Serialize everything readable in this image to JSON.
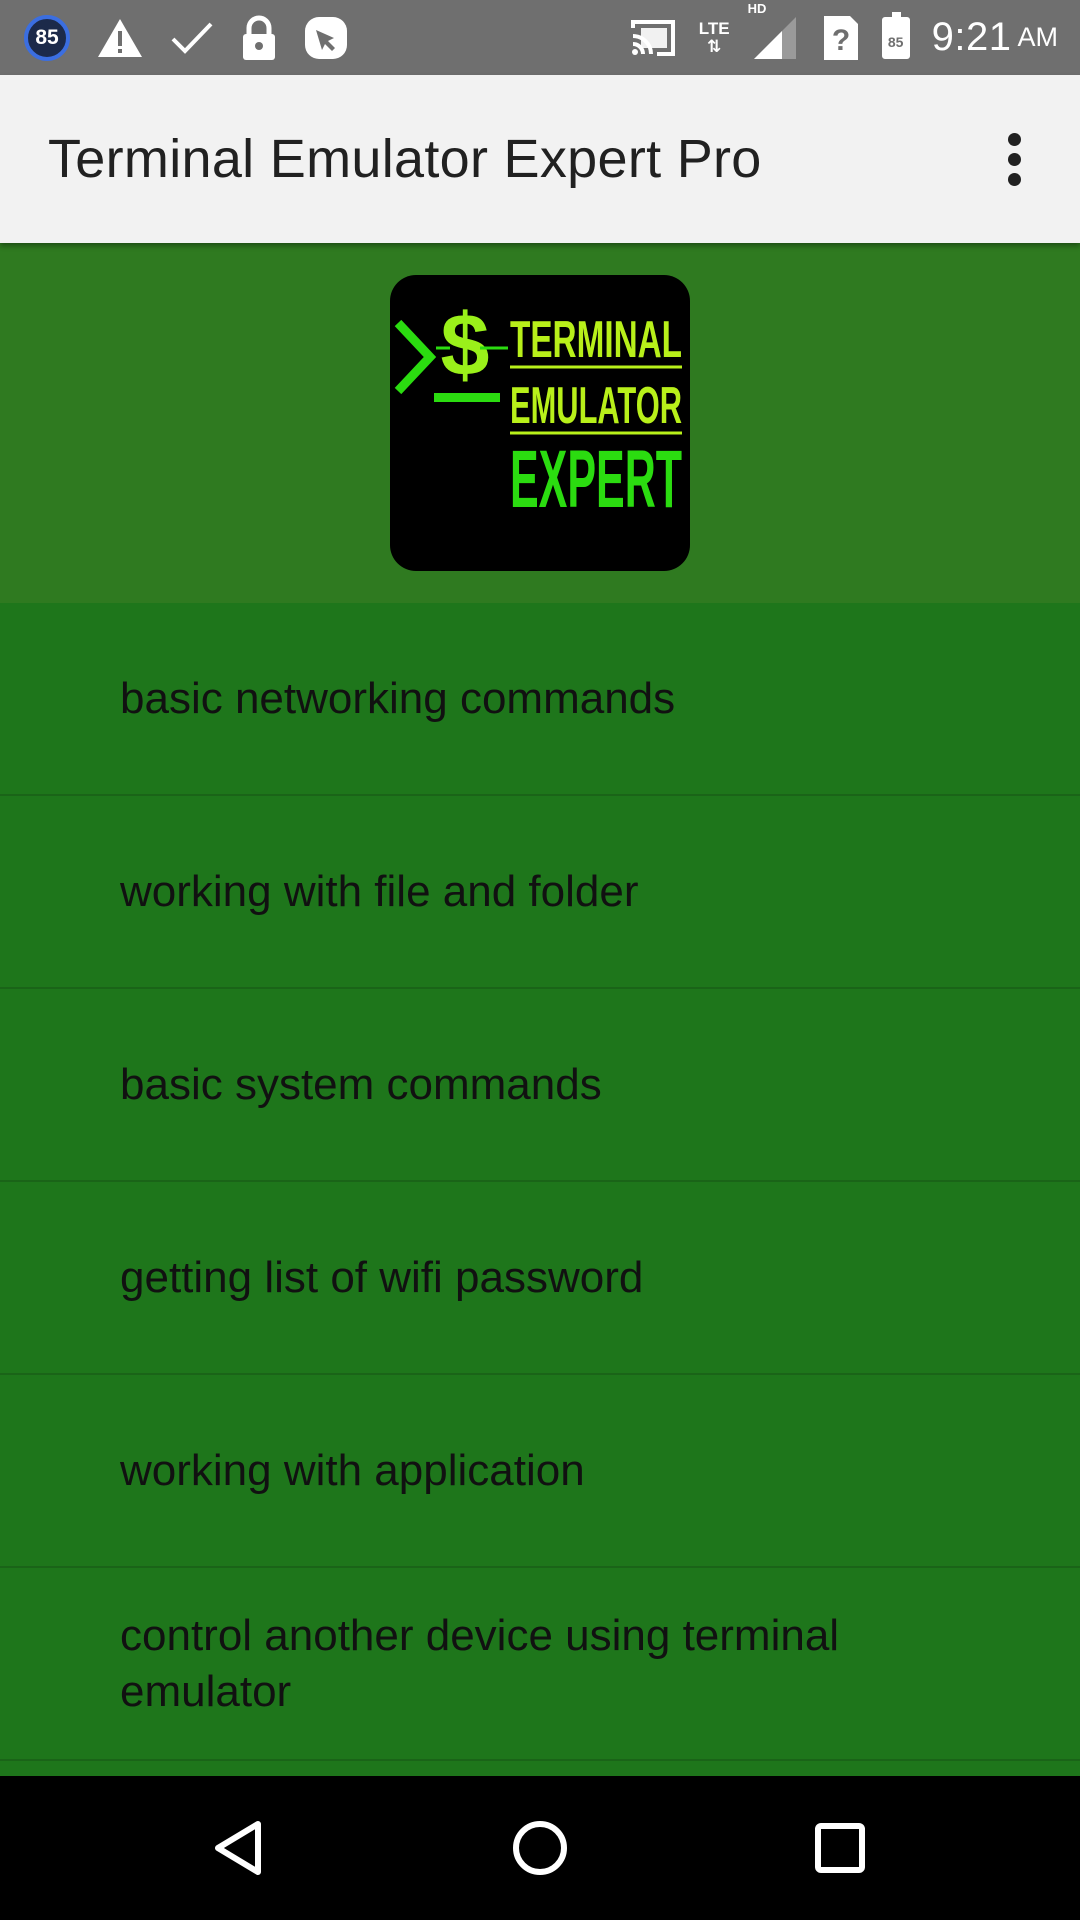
{
  "status_bar": {
    "notification_badge": "85",
    "lte_label": "LTE",
    "hd_label": "HD",
    "battery_level": "85",
    "time": "9:21",
    "ampm": "AM"
  },
  "app_bar": {
    "title": "Terminal Emulator Expert Pro"
  },
  "logo": {
    "line1": "TERMINAL",
    "line2": "EMULATOR",
    "line3": "EXPERT",
    "symbol": "$"
  },
  "menu": {
    "items": [
      {
        "label": "basic networking commands"
      },
      {
        "label": "working with file and folder"
      },
      {
        "label": "basic system commands"
      },
      {
        "label": "getting list of wifi password"
      },
      {
        "label": "working with application"
      },
      {
        "label": "control another device using terminal emulator"
      }
    ]
  },
  "colors": {
    "list_background": "#1e761b",
    "header_background": "#2f7a20",
    "app_bar": "#f2f2f2",
    "status_bar": "#6f6f6f",
    "logo_green": "#2bdc10",
    "logo_yellow": "#b8f01a"
  }
}
